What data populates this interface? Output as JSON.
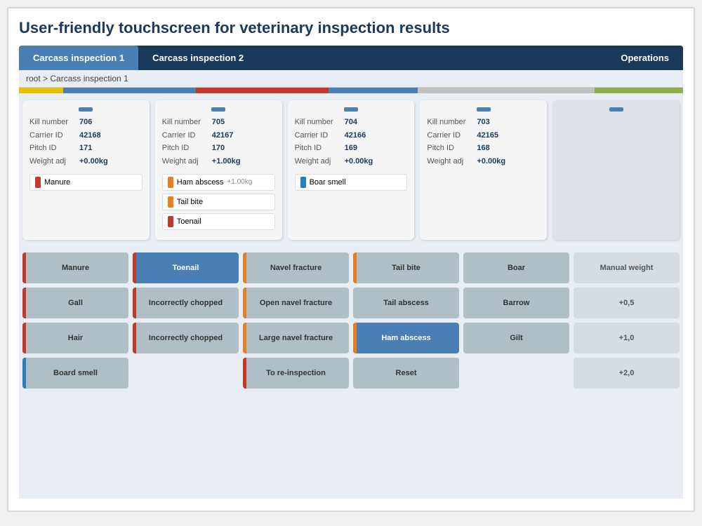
{
  "page": {
    "title": "User-friendly touchscreen for veterinary inspection results"
  },
  "tabs": [
    {
      "id": "tab1",
      "label": "Carcass inspection 1",
      "active": true
    },
    {
      "id": "tab2",
      "label": "Carcass inspection 2",
      "active": false
    },
    {
      "id": "ops",
      "label": "Operations",
      "active": false
    }
  ],
  "breadcrumb": "root > Carcass inspection 1",
  "colorBar": [
    {
      "color": "#e8c200",
      "flex": 1
    },
    {
      "color": "#4a7fb5",
      "flex": 3
    },
    {
      "color": "#c0392b",
      "flex": 3
    },
    {
      "color": "#4a7fb5",
      "flex": 2
    },
    {
      "color": "#c0c0c0",
      "flex": 4
    },
    {
      "color": "#8fb04a",
      "flex": 2
    }
  ],
  "cards": [
    {
      "killNumber": "706",
      "carrierId": "42168",
      "pitchId": "171",
      "weightAdj": "+0.00kg",
      "badges": [
        {
          "color": "red",
          "label": "Manure",
          "extra": ""
        }
      ]
    },
    {
      "killNumber": "705",
      "carrierId": "42167",
      "pitchId": "170",
      "weightAdj": "+1.00kg",
      "badges": [
        {
          "color": "orange",
          "label": "Ham abscess",
          "extra": "+1.00kg"
        },
        {
          "color": "orange",
          "label": "Tail bite",
          "extra": ""
        },
        {
          "color": "red",
          "label": "Toenail",
          "extra": ""
        }
      ]
    },
    {
      "killNumber": "704",
      "carrierId": "42166",
      "pitchId": "169",
      "weightAdj": "+0.00kg",
      "badges": [
        {
          "color": "blue",
          "label": "Boar smell",
          "extra": ""
        }
      ]
    },
    {
      "killNumber": "703",
      "carrierId": "42165",
      "pitchId": "168",
      "weightAdj": "+0.00kg",
      "badges": []
    },
    {
      "killNumber": "",
      "carrierId": "",
      "pitchId": "",
      "weightAdj": "",
      "badges": []
    }
  ],
  "buttons": {
    "rows": [
      [
        {
          "label": "Manure",
          "barColor": "red",
          "style": "normal"
        },
        {
          "label": "Toenail",
          "barColor": "red",
          "style": "active-blue"
        },
        {
          "label": "Navel fracture",
          "barColor": "orange",
          "style": "normal"
        },
        {
          "label": "Tail bite",
          "barColor": "orange",
          "style": "normal"
        },
        {
          "label": "Boar",
          "barColor": "",
          "style": "normal"
        },
        {
          "label": "Manual weight",
          "barColor": "",
          "style": "light-gray"
        }
      ],
      [
        {
          "label": "Gall",
          "barColor": "red",
          "style": "normal"
        },
        {
          "label": "Incorrectly chopped",
          "barColor": "red",
          "style": "normal"
        },
        {
          "label": "Open navel fracture",
          "barColor": "orange",
          "style": "normal"
        },
        {
          "label": "Tail abscess",
          "barColor": "",
          "style": "normal"
        },
        {
          "label": "Barrow",
          "barColor": "",
          "style": "normal"
        },
        {
          "label": "+0,5",
          "barColor": "",
          "style": "light-gray"
        }
      ],
      [
        {
          "label": "Hair",
          "barColor": "red",
          "style": "normal"
        },
        {
          "label": "Incorrectly chopped",
          "barColor": "red",
          "style": "normal"
        },
        {
          "label": "Large navel fracture",
          "barColor": "orange",
          "style": "normal"
        },
        {
          "label": "Ham abscess",
          "barColor": "orange",
          "style": "active-blue"
        },
        {
          "label": "Gilt",
          "barColor": "",
          "style": "normal"
        },
        {
          "label": "+1,0",
          "barColor": "",
          "style": "light-gray"
        }
      ],
      [
        {
          "label": "Board smell",
          "barColor": "blue",
          "style": "normal"
        },
        {
          "label": "",
          "barColor": "",
          "style": "empty"
        },
        {
          "label": "To re-inspection",
          "barColor": "red",
          "style": "normal"
        },
        {
          "label": "Reset",
          "barColor": "",
          "style": "normal"
        },
        {
          "label": "",
          "barColor": "",
          "style": "empty"
        },
        {
          "label": "+2,0",
          "barColor": "",
          "style": "light-gray"
        }
      ]
    ]
  }
}
